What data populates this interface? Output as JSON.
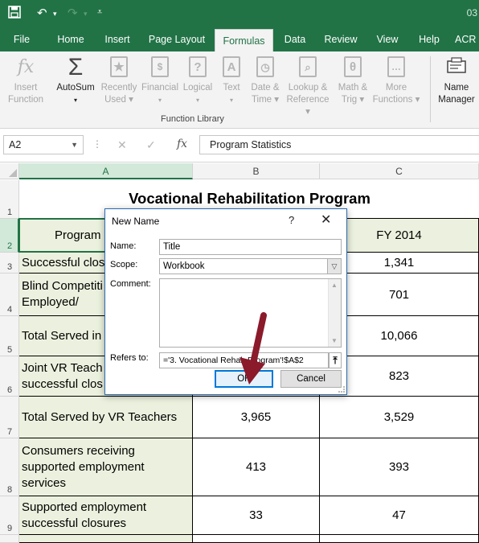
{
  "titlebar": {
    "file_label_partial": "03"
  },
  "tabs": [
    {
      "label": "File"
    },
    {
      "label": "Home"
    },
    {
      "label": "Insert"
    },
    {
      "label": "Page Layout"
    },
    {
      "label": "Formulas"
    },
    {
      "label": "Data"
    },
    {
      "label": "Review"
    },
    {
      "label": "View"
    },
    {
      "label": "Help"
    },
    {
      "label": "ACR"
    }
  ],
  "ribbon": {
    "insert_function": "Insert\nFunction",
    "autosum": "AutoSum",
    "recently_used": "Recently\nUsed",
    "financial": "Financial",
    "logical": "Logical",
    "text": "Text",
    "date_time": "Date &\nTime",
    "lookup": "Lookup &\nReference",
    "math": "Math &\nTrig",
    "more": "More\nFunctions",
    "name_manager": "Name\nManager",
    "group_label": "Function Library"
  },
  "formula_bar": {
    "name_box": "A2",
    "fx": "fx",
    "content": "Program Statistics"
  },
  "grid": {
    "columns": [
      "A",
      "B",
      "C"
    ],
    "rows": [
      "1",
      "2",
      "3",
      "4",
      "5",
      "6",
      "7",
      "8",
      "9"
    ],
    "title": "Vocational Rehabilitation Program",
    "header_a": "Program",
    "header_c": "FY 2014",
    "a3": "Successful clos",
    "c3": "1,341",
    "a4": "Blind Competiti\nEmployed/",
    "c4": "701",
    "a5": "Total Served in",
    "c5": "10,066",
    "a6": "Joint VR Teach\nsuccessful clos",
    "c6": "823",
    "a7": "Total Served by VR Teachers",
    "b7": "3,965",
    "c7": "3,529",
    "a8": "Consumers receiving\nsupported employment\nservices",
    "b8": "413",
    "c8": "393",
    "a9": "Supported employment\nsuccessful closures",
    "b9": "33",
    "c9": "47"
  },
  "dialog": {
    "title": "New Name",
    "help": "?",
    "close": "✕",
    "name_label": "Name:",
    "name_value": "Title",
    "scope_label": "Scope:",
    "scope_value": "Workbook",
    "comment_label": "Comment:",
    "refers_label": "Refers to:",
    "refers_value": "='3. Vocational Rehab Program'!$A$2",
    "ok": "OK",
    "cancel": "Cancel"
  },
  "colors": {
    "excel_green": "#217346",
    "label_fill": "#ebf1de",
    "arrow": "#8b1a2b"
  }
}
